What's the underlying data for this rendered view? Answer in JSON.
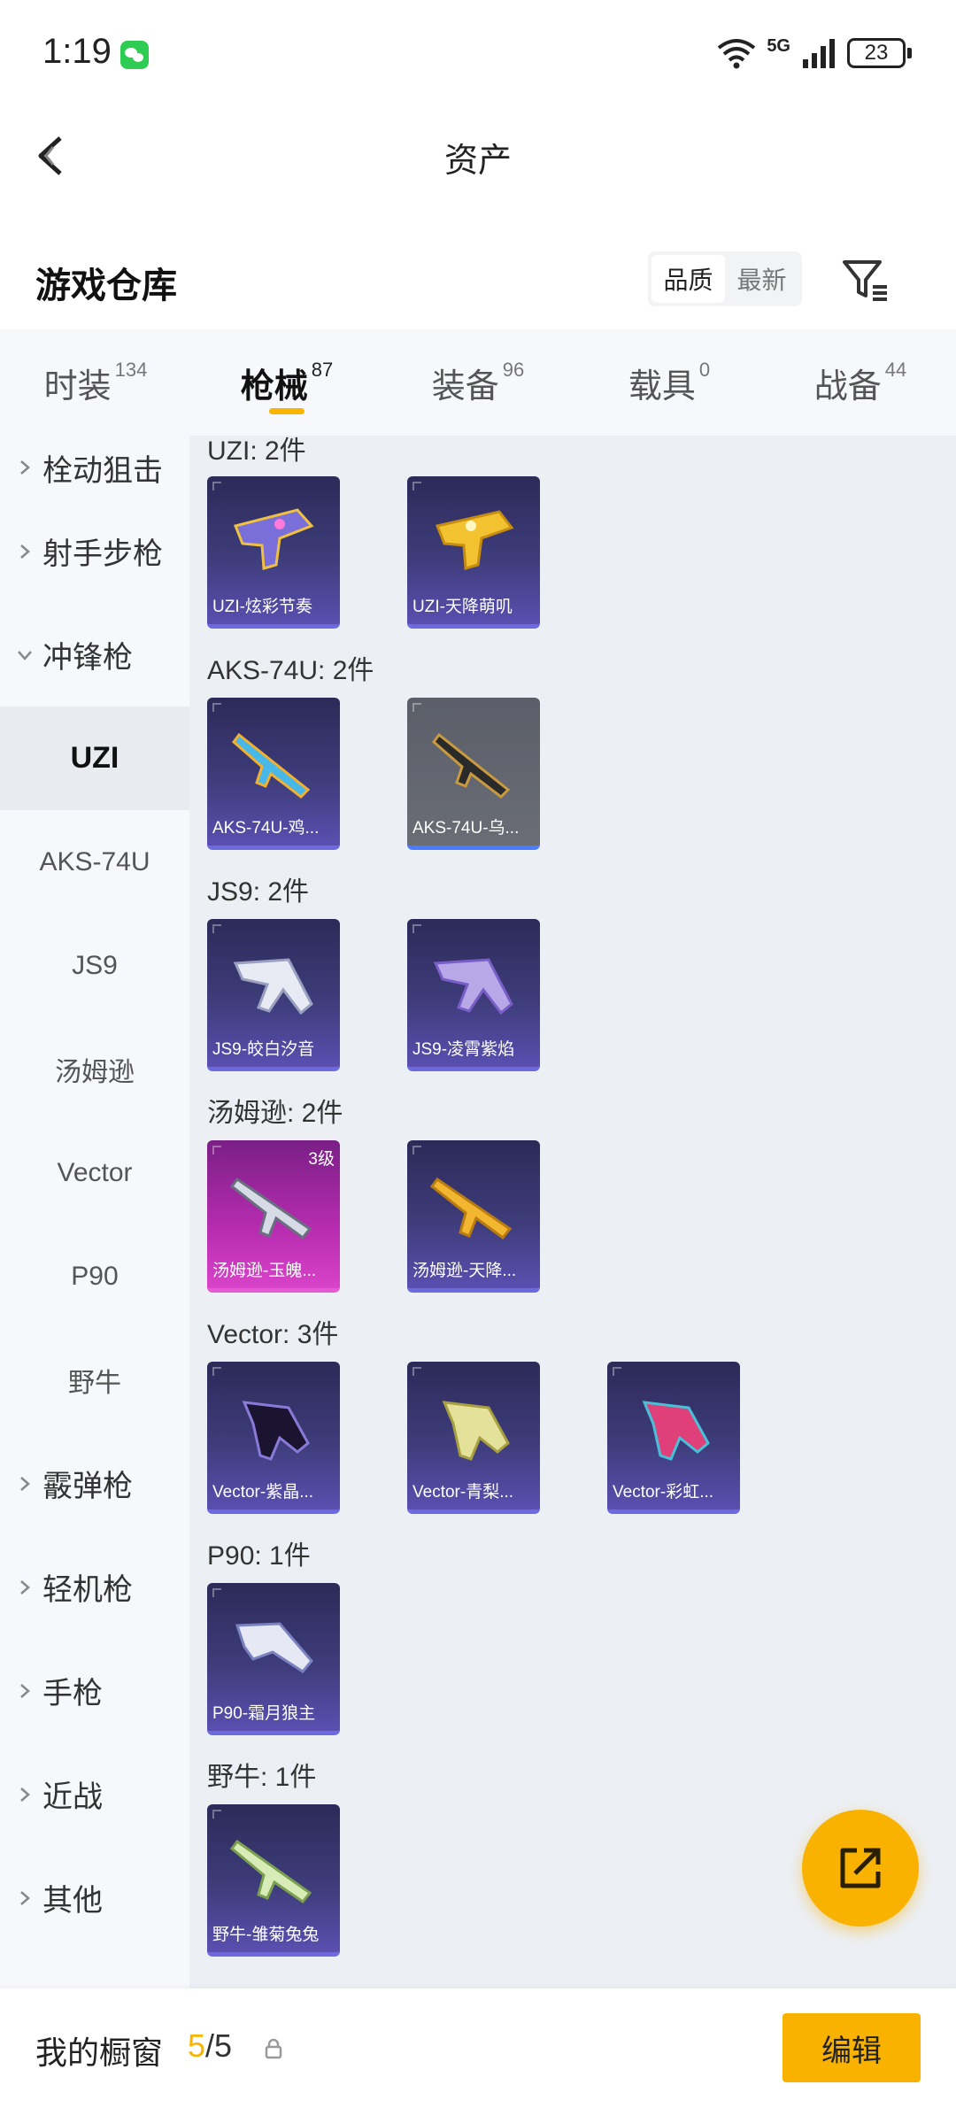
{
  "status_bar": {
    "time": "1:19",
    "network": "5G",
    "battery": "23"
  },
  "nav": {
    "title": "资产"
  },
  "warehouse": {
    "title": "游戏仓库",
    "sort_quality": "品质",
    "sort_newest": "最新"
  },
  "tabs": [
    {
      "label": "时装",
      "count": "134"
    },
    {
      "label": "枪械",
      "count": "87"
    },
    {
      "label": "装备",
      "count": "96"
    },
    {
      "label": "载具",
      "count": "0"
    },
    {
      "label": "战备",
      "count": "44"
    }
  ],
  "sidebar": {
    "items": [
      {
        "label": "栓动狙击"
      },
      {
        "label": "射手步枪"
      },
      {
        "label": "冲锋枪"
      },
      {
        "label": "UZI"
      },
      {
        "label": "AKS-74U"
      },
      {
        "label": "JS9"
      },
      {
        "label": "汤姆逊"
      },
      {
        "label": "Vector"
      },
      {
        "label": "P90"
      },
      {
        "label": "野牛"
      },
      {
        "label": "霰弹枪"
      },
      {
        "label": "轻机枪"
      },
      {
        "label": "手枪"
      },
      {
        "label": "近战"
      },
      {
        "label": "其他"
      }
    ]
  },
  "groups": [
    {
      "label": "UZI: 2件",
      "items": [
        {
          "name": "UZI-炫彩节奏"
        },
        {
          "name": "UZI-天降萌叽"
        }
      ]
    },
    {
      "label": "AKS-74U: 2件",
      "items": [
        {
          "name": "AKS-74U-鸡..."
        },
        {
          "name": "AKS-74U-乌..."
        }
      ]
    },
    {
      "label": "JS9: 2件",
      "items": [
        {
          "name": "JS9-皎白汐音"
        },
        {
          "name": "JS9-凌霄紫焰"
        }
      ]
    },
    {
      "label": "汤姆逊: 2件",
      "items": [
        {
          "name": "汤姆逊-玉魄...",
          "badge": "3级"
        },
        {
          "name": "汤姆逊-天降..."
        }
      ]
    },
    {
      "label": "Vector: 3件",
      "items": [
        {
          "name": "Vector-紫晶..."
        },
        {
          "name": "Vector-青梨..."
        },
        {
          "name": "Vector-彩虹..."
        }
      ]
    },
    {
      "label": "P90: 1件",
      "items": [
        {
          "name": "P90-霜月狼主"
        }
      ]
    },
    {
      "label": "野牛: 1件",
      "items": [
        {
          "name": "野牛-雏菊兔兔"
        }
      ]
    }
  ],
  "bottom_bar": {
    "label": "我的橱窗",
    "count_current": "5",
    "count_total": "/5",
    "edit_label": "编辑"
  },
  "colors": {
    "accent": "#f9b200",
    "card_purple": "#3e3c7a",
    "card_pink": "#b72cb0"
  }
}
